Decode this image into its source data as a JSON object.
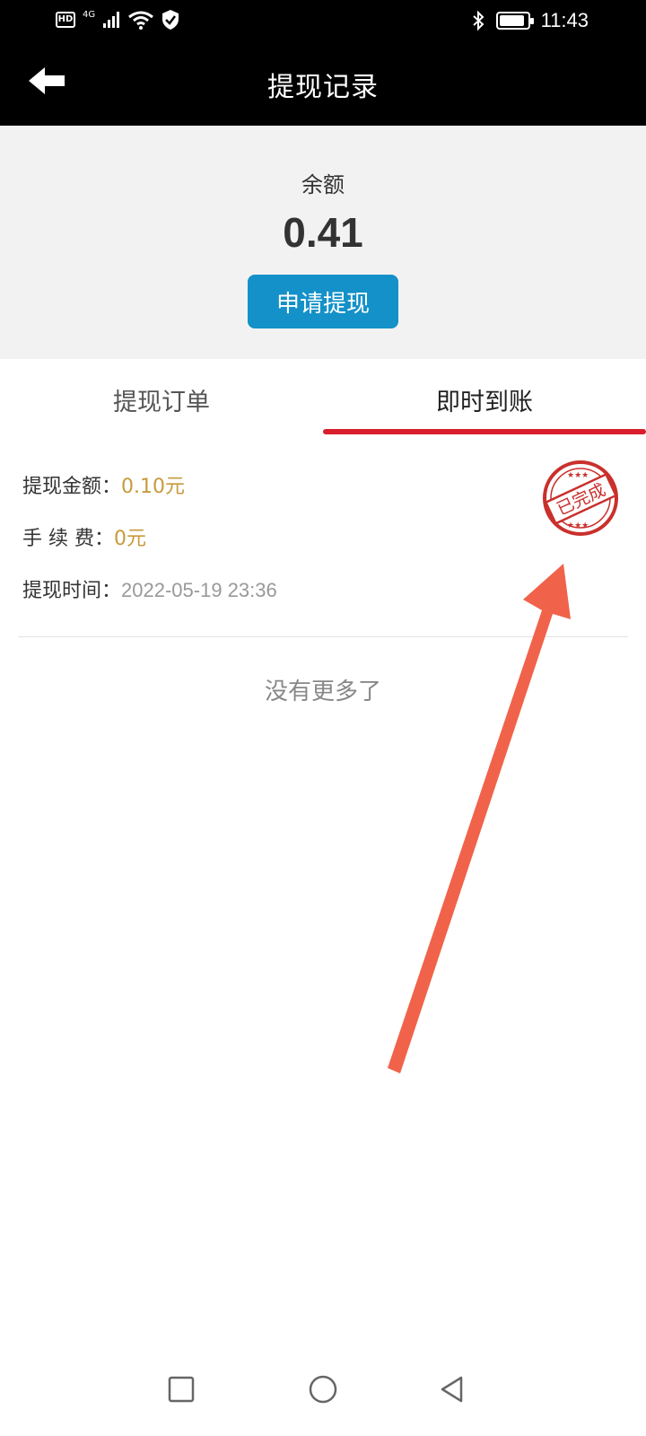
{
  "status_bar": {
    "hd": "HD",
    "network": "4G",
    "time": "11:43",
    "battery_level": 0.9
  },
  "header": {
    "title": "提现记录"
  },
  "balance": {
    "label": "余额",
    "value": "0.41",
    "withdraw_button": "申请提现"
  },
  "tabs": [
    {
      "label": "提现订单",
      "active": false
    },
    {
      "label": "即时到账",
      "active": true
    }
  ],
  "record": {
    "amount_label": "提现金额：",
    "amount_value": "0.10元",
    "fee_label": "手 续 费：",
    "fee_value": "0元",
    "time_label": "提现时间：",
    "time_value": "2022-05-19 23:36",
    "stamp_text": "已完成"
  },
  "footer_text": "没有更多了",
  "colors": {
    "header_bg": "#000000",
    "accent_blue": "#1491c8",
    "tab_underline": "#d81e2c",
    "value_gold": "#c79a3c",
    "stamp_red": "#c9302c",
    "arrow": "#f0634a"
  },
  "icons": [
    "back-arrow-icon",
    "stamp-icon",
    "recent-apps-icon",
    "home-icon",
    "back-nav-icon"
  ]
}
